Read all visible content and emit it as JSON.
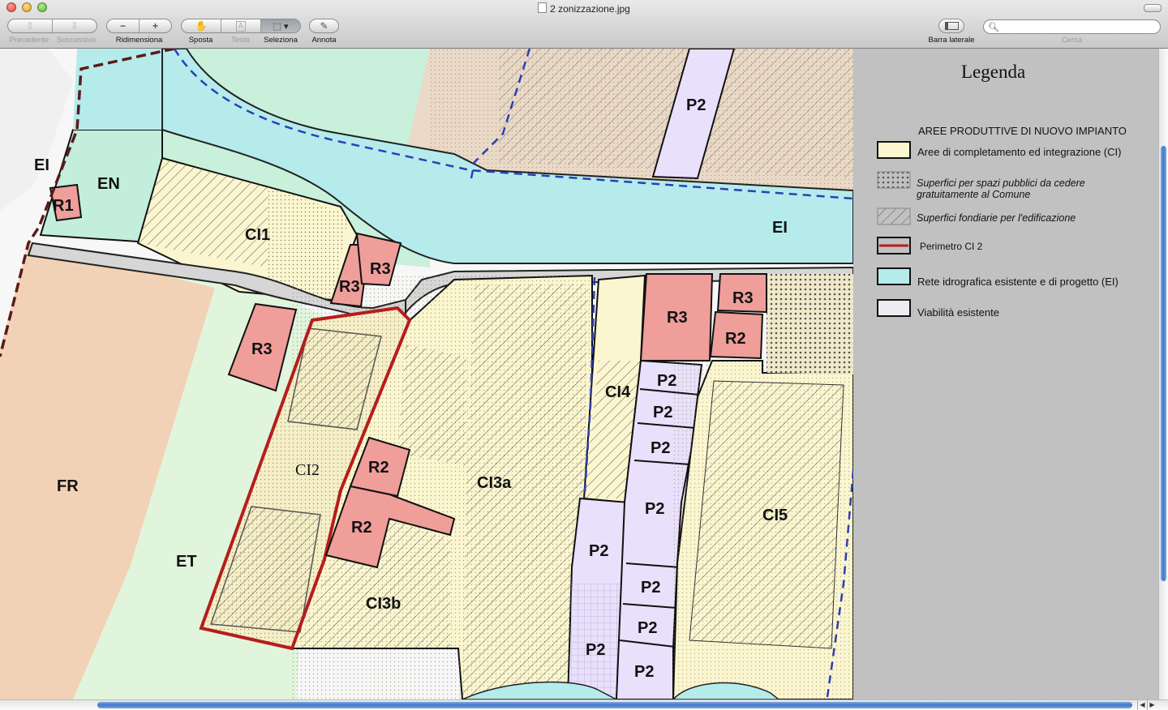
{
  "window": {
    "title": "2 zonizzazione.jpg"
  },
  "toolbar": {
    "prev_label": "Precedente",
    "next_label": "Successivo",
    "resize_label": "Ridimensiona",
    "move_label": "Sposta",
    "text_label": "Testo",
    "select_label": "Seleziona",
    "annotate_label": "Annota",
    "sidebar_label": "Barra laterale",
    "search_label": "Cerca",
    "search_value": ""
  },
  "map": {
    "zones": {
      "ei_left": "EI",
      "en": "EN",
      "r1": "R1",
      "ci1": "CI1",
      "r3_a": "R3",
      "r3_b": "R3",
      "r3_c": "R3",
      "ei_main": "EI",
      "p2_top": "P2",
      "r3_d": "R3",
      "r3_e": "R3",
      "r2_a": "R2",
      "p2_a": "P2",
      "p2_b": "P2",
      "p2_c": "P2",
      "ci4": "CI4",
      "fr": "FR",
      "ci2": "CI2",
      "r2_b": "R2",
      "r2_c": "R2",
      "ci3a": "CI3a",
      "p2_d": "P2",
      "ci5": "CI5",
      "et": "ET",
      "p2_e": "P2",
      "p2_f": "P2",
      "ci3b": "CI3b",
      "p2_g": "P2",
      "p2_h": "P2",
      "p2_i": "P2"
    }
  },
  "legend": {
    "title": "Legenda",
    "heading": "AREE PRODUTTIVE DI NUOVO IMPIANTO",
    "items": [
      {
        "line1": "Aree di completamento ed integrazione (CI)",
        "line2": ""
      },
      {
        "line1": "Superfici per spazi pubblici da cedere",
        "line2": "gratuitamente al Comune"
      },
      {
        "line1": "Superfici fondiarie per l'edificazione",
        "line2": ""
      },
      {
        "line1": "Perimetro CI 2",
        "line2": ""
      },
      {
        "line1": "Rete idrografica esistente e di progetto (EI)",
        "line2": ""
      },
      {
        "line1": "Viabilità  esistente",
        "line2": ""
      }
    ]
  },
  "colors": {
    "fr_zone": "#f2d2b6",
    "et_zone": "#e1f5dc",
    "en_zone": "#c3eedc",
    "ci_zone": "#fbf6cf",
    "ei_water": "#b6ebec",
    "road": "#d6d6d6",
    "r_zone": "#ef9e9a",
    "p2_zone": "#e9e0fb",
    "perimeter": "#b51d1d",
    "legend_bg": "#c1c1c1",
    "scroll_thumb": "#3f79c9"
  }
}
